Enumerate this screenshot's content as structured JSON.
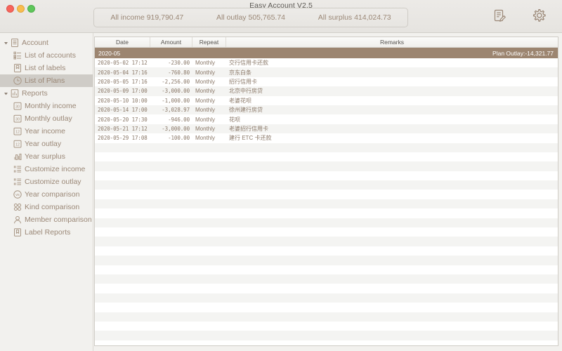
{
  "window": {
    "title": "Easy Account V2.5",
    "traffic_lights": [
      "close",
      "minimize",
      "maximize"
    ]
  },
  "toolbar": {
    "summary": [
      {
        "label": "All income 919,790.47"
      },
      {
        "label": "All outlay 505,765.74"
      },
      {
        "label": "All surplus 414,024.73"
      }
    ],
    "actions": [
      {
        "name": "note-edit-icon"
      },
      {
        "name": "gear-icon"
      }
    ]
  },
  "sidebar": {
    "items": [
      {
        "label": "Account",
        "icon": "list-document-icon",
        "level": "group",
        "expanded": true,
        "selected": false
      },
      {
        "label": "List of accounts",
        "icon": "accounts-list-icon",
        "level": "child",
        "selected": false
      },
      {
        "label": "List of labels",
        "icon": "label-tag-icon",
        "level": "child",
        "selected": false
      },
      {
        "label": "List of Plans",
        "icon": "clock-icon",
        "level": "child",
        "selected": true
      },
      {
        "label": "Reports",
        "icon": "bar-chart-icon",
        "level": "group",
        "expanded": true,
        "selected": false
      },
      {
        "label": "Monthly income",
        "icon": "calendar-30-icon",
        "level": "child",
        "selected": false
      },
      {
        "label": "Monthly outlay",
        "icon": "calendar-30-icon",
        "level": "child",
        "selected": false
      },
      {
        "label": "Year income",
        "icon": "calendar-12-icon",
        "level": "child",
        "selected": false
      },
      {
        "label": "Year outlay",
        "icon": "calendar-12-icon",
        "level": "child",
        "selected": false
      },
      {
        "label": "Year surplus",
        "icon": "bar-chart-small-icon",
        "level": "child",
        "selected": false
      },
      {
        "label": "Customize income",
        "icon": "sliders-icon",
        "level": "child",
        "selected": false
      },
      {
        "label": "Customize outlay",
        "icon": "sliders-icon",
        "level": "child",
        "selected": false
      },
      {
        "label": "Year comparison",
        "icon": "versus-circle-icon",
        "level": "child",
        "selected": false
      },
      {
        "label": "Kind comparison",
        "icon": "four-circles-icon",
        "level": "child",
        "selected": false
      },
      {
        "label": "Member comparison",
        "icon": "person-icon",
        "level": "child",
        "selected": false
      },
      {
        "label": "Label Reports",
        "icon": "bookmark-icon",
        "level": "child",
        "selected": false
      }
    ]
  },
  "table": {
    "columns": [
      {
        "key": "date",
        "label": "Date"
      },
      {
        "key": "amount",
        "label": "Amount"
      },
      {
        "key": "repeat",
        "label": "Repeat"
      },
      {
        "key": "remarks",
        "label": "Remarks"
      }
    ],
    "group": {
      "label": "2020-05",
      "summary": "Plan Outlay:-14,321.77"
    },
    "rows": [
      {
        "date": "2020-05-02 17:12",
        "amount": "-230.00",
        "repeat": "Monthly",
        "remarks": "交行信用卡还款"
      },
      {
        "date": "2020-05-04 17:16",
        "amount": "-760.80",
        "repeat": "Monthly",
        "remarks": "京东白条"
      },
      {
        "date": "2020-05-05 17:16",
        "amount": "-2,256.00",
        "repeat": "Monthly",
        "remarks": "招行信用卡"
      },
      {
        "date": "2020-05-09 17:00",
        "amount": "-3,000.00",
        "repeat": "Monthly",
        "remarks": "北京中行房贷"
      },
      {
        "date": "2020-05-10 10:00",
        "amount": "-1,000.00",
        "repeat": "Monthly",
        "remarks": "老婆花呗"
      },
      {
        "date": "2020-05-14 17:00",
        "amount": "-3,028.97",
        "repeat": "Monthly",
        "remarks": "徐州建行房贷"
      },
      {
        "date": "2020-05-20 17:30",
        "amount": "-946.00",
        "repeat": "Monthly",
        "remarks": "花呗"
      },
      {
        "date": "2020-05-21 17:12",
        "amount": "-3,000.00",
        "repeat": "Monthly",
        "remarks": "老婆招行信用卡"
      },
      {
        "date": "2020-05-29 17:08",
        "amount": "-100.00",
        "repeat": "Monthly",
        "remarks": "建行 ETC 卡还款"
      }
    ],
    "empty_row_count": 22
  },
  "colors": {
    "accent_brown": "#9c8570",
    "text_brown": "#9b8877",
    "chrome": "#f2f1ee"
  }
}
